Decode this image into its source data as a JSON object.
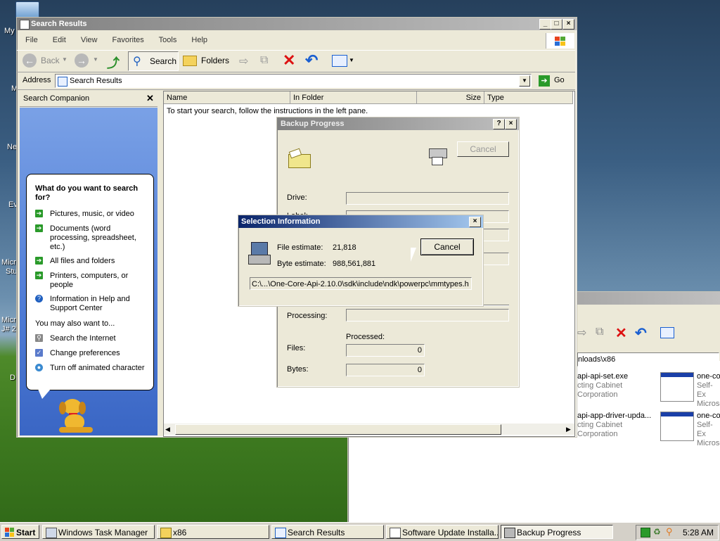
{
  "desktop": {
    "labels": [
      "My",
      "M",
      "Ne",
      "Ev",
      "Micro",
      "Stu",
      "Micro",
      "J# 2",
      "D"
    ]
  },
  "explorer": {
    "title": "Search Results",
    "menu": [
      "File",
      "Edit",
      "View",
      "Favorites",
      "Tools",
      "Help"
    ],
    "toolbar": {
      "back": "Back",
      "search": "Search",
      "folders": "Folders"
    },
    "address_label": "Address",
    "address_value": "Search Results",
    "go_label": "Go",
    "companion_title": "Search Companion",
    "question": "What do you want to search for?",
    "options": [
      "Pictures, music, or video",
      "Documents (word processing, spreadsheet, etc.)",
      "All files and folders",
      "Printers, computers, or people",
      "Information in Help and Support Center"
    ],
    "also_label": "You may also want to...",
    "also": [
      "Search the Internet",
      "Change preferences",
      "Turn off animated character"
    ],
    "columns": [
      "Name",
      "In Folder",
      "Size",
      "Type"
    ],
    "empty_message": "To start your search, follow the instructions in the left pane."
  },
  "backup_progress": {
    "title": "Backup Progress",
    "cancel": "Cancel",
    "drive_label": "Drive:",
    "label_label": "Label:",
    "processing_label": "Processing:",
    "processed_label": "Processed:",
    "files_label": "Files:",
    "files_value": "0",
    "bytes_label": "Bytes:",
    "bytes_value": "0"
  },
  "selection_info": {
    "title": "Selection Information",
    "file_estimate_label": "File estimate:",
    "file_estimate_value": "21,818",
    "byte_estimate_label": "Byte estimate:",
    "byte_estimate_value": "988,561,881",
    "cancel": "Cancel",
    "path": "C:\\...\\One-Core-Api-2.10.0\\sdk\\include\\ndk\\powerpc\\mmtypes.h"
  },
  "background_window": {
    "address_fragment": "nloads\\x86",
    "files": [
      {
        "name": "api-api-set.exe",
        "line2": "cting Cabinet",
        "line3": "Corporation"
      },
      {
        "name": "api-app-driver-upda...",
        "line2": "cting Cabinet",
        "line3": "Corporation"
      }
    ],
    "right_files": [
      {
        "name": "one-co",
        "line2": "Self-Ex",
        "line3": "Microsc"
      },
      {
        "name": "one-co",
        "line2": "Self-Ex",
        "line3": "Microsc"
      }
    ]
  },
  "taskbar": {
    "start": "Start",
    "tasks": [
      "Windows Task Manager",
      "x86",
      "Search Results",
      "Software Update Installa...",
      "Backup Progress"
    ],
    "clock": "5:28 AM"
  }
}
